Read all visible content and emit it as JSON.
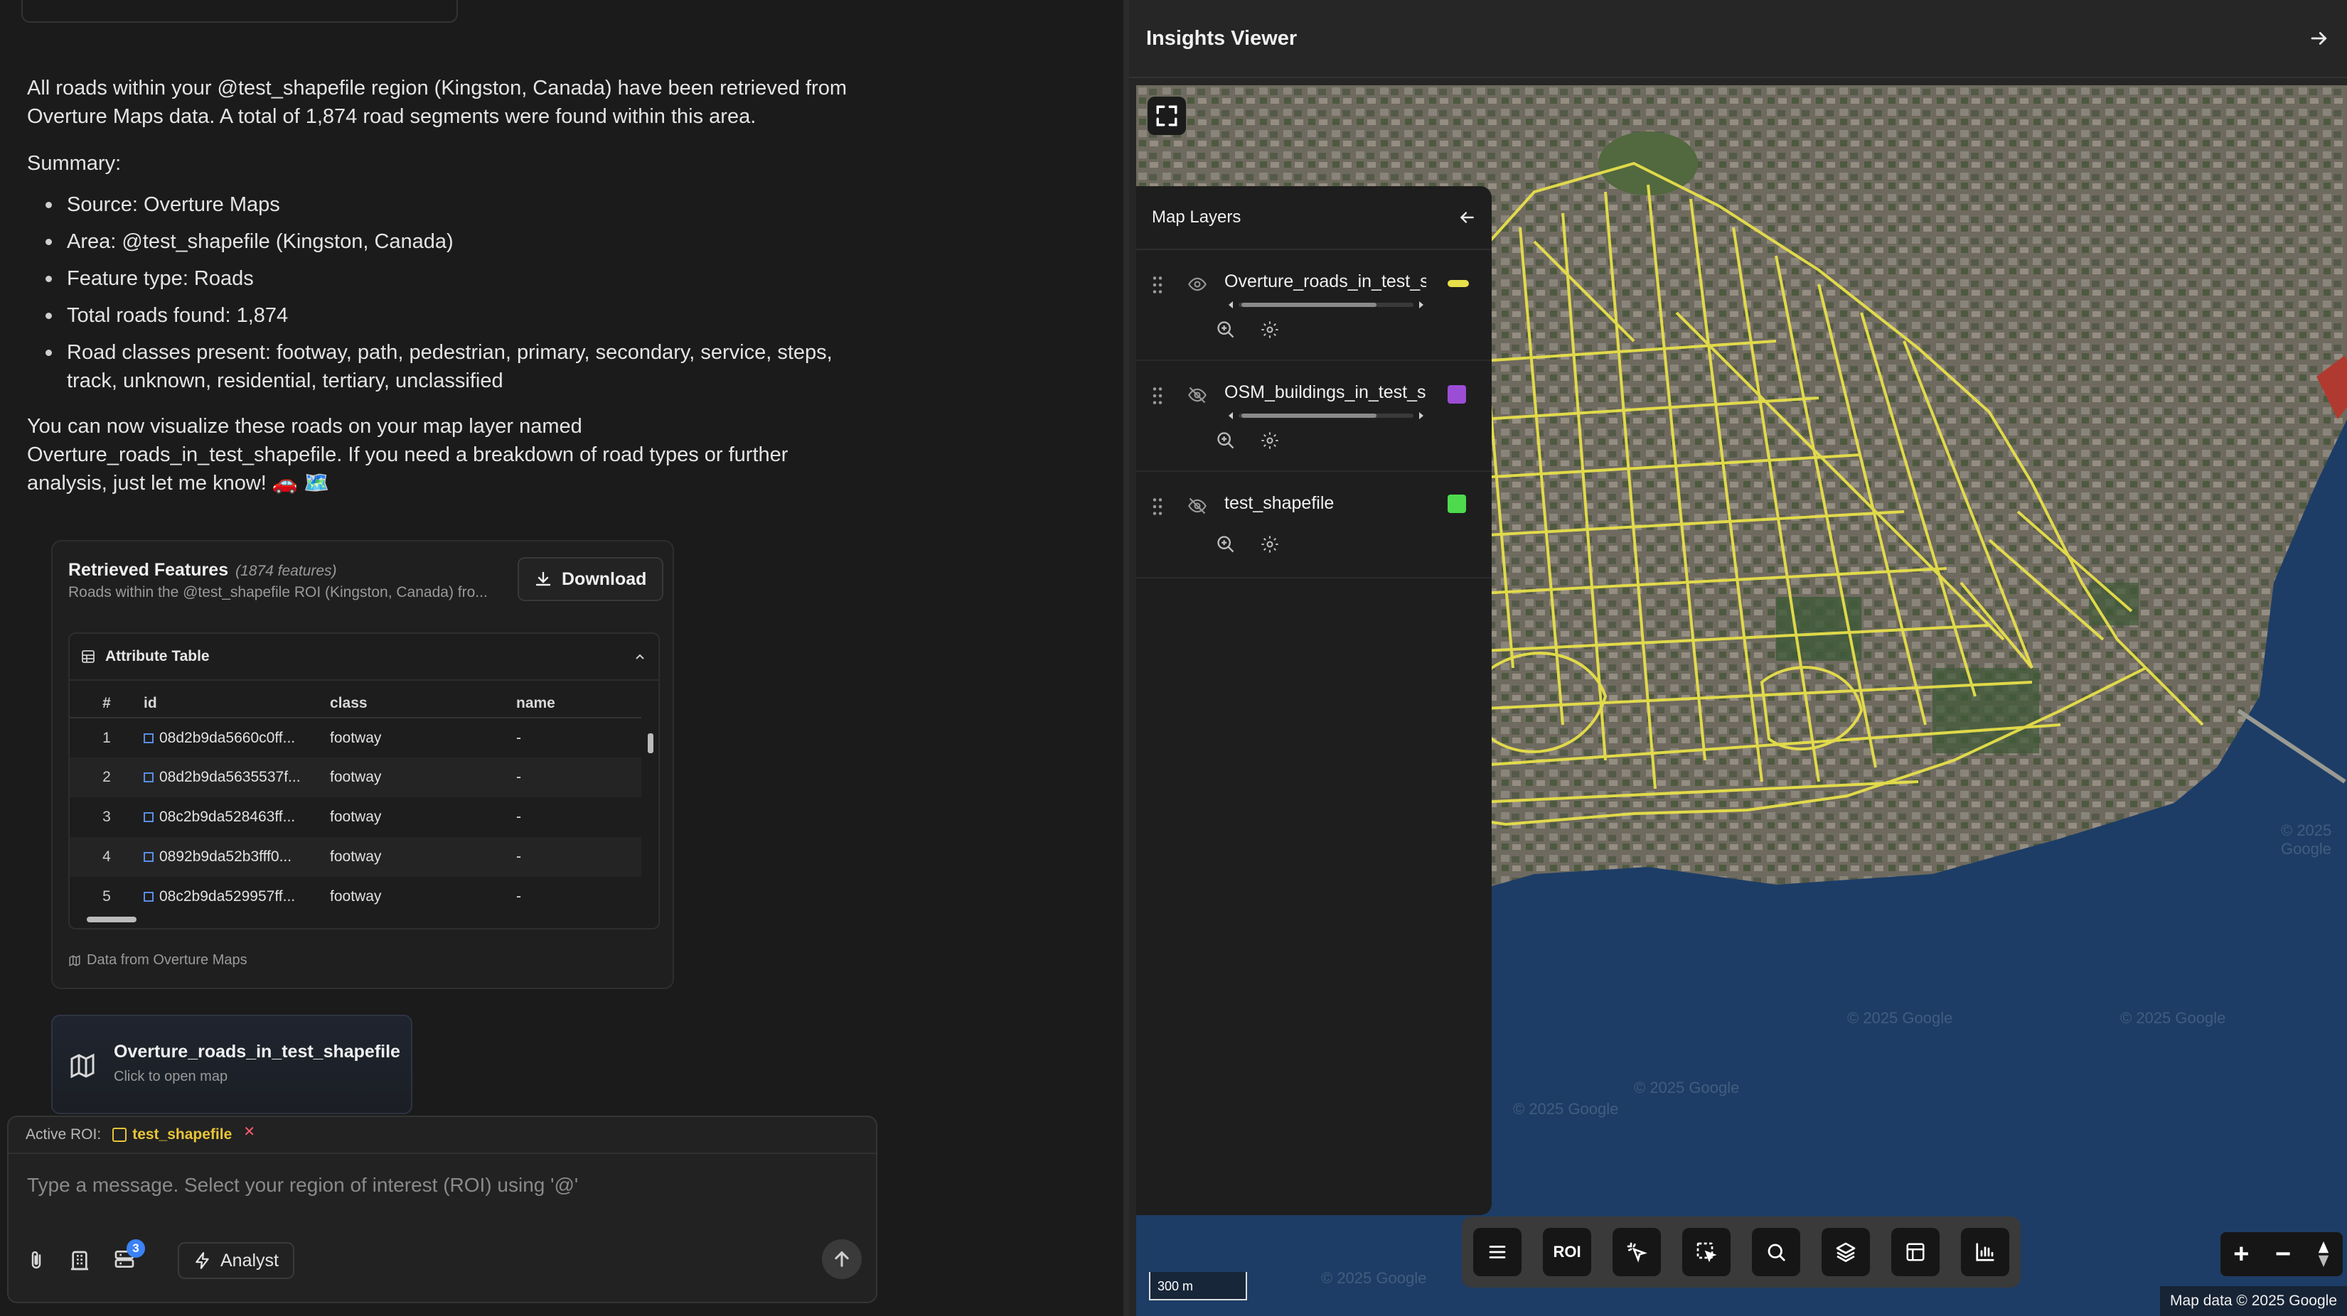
{
  "chat": {
    "intro": "All roads within your @test_shapefile region (Kingston, Canada) have been retrieved from Overture Maps data. A total of 1,874 road segments were found within this area.",
    "summary_label": "Summary:",
    "bullets": [
      "Source: Overture Maps",
      "Area: @test_shapefile (Kingston, Canada)",
      "Feature type: Roads",
      "Total roads found: 1,874",
      "Road classes present: footway, path, pedestrian, primary, secondary, service, steps, track, unknown, residential, tertiary, unclassified"
    ],
    "outro": "You can now visualize these roads on your map layer named Overture_roads_in_test_shapefile. If you need a breakdown of road types or further analysis, just let me know! 🚗 🗺️"
  },
  "features_card": {
    "title": "Retrieved Features",
    "count": "(1874 features)",
    "subtitle": "Roads within the @test_shapefile ROI (Kingston, Canada) fro...",
    "download_label": "Download",
    "table_title": "Attribute Table",
    "columns": [
      "#",
      "id",
      "class",
      "name"
    ],
    "rows": [
      {
        "n": "1",
        "id": "08d2b9da5660c0ff...",
        "class": "footway",
        "name": "-"
      },
      {
        "n": "2",
        "id": "08d2b9da5635537f...",
        "class": "footway",
        "name": "-"
      },
      {
        "n": "3",
        "id": "08c2b9da528463ff...",
        "class": "footway",
        "name": "-"
      },
      {
        "n": "4",
        "id": "0892b9da52b3fff0...",
        "class": "footway",
        "name": "-"
      },
      {
        "n": "5",
        "id": "08c2b9da529957ff...",
        "class": "footway",
        "name": "-"
      }
    ],
    "footer": "Data from Overture Maps"
  },
  "map_link": {
    "title": "Overture_roads_in_test_shapefile",
    "subtitle": "Click to open map"
  },
  "composer": {
    "roi_label": "Active ROI:",
    "roi_value": "test_shapefile",
    "placeholder": "Type a message. Select your region of interest (ROI) using '@'",
    "badge_count": "3",
    "mode_label": "Analyst"
  },
  "viewer": {
    "title": "Insights Viewer",
    "layers_title": "Map Layers",
    "layers": [
      {
        "name": "Overture_roads_in_test_sl",
        "visible": true,
        "color": "#e8e04a",
        "swatch": "line"
      },
      {
        "name": "OSM_buildings_in_test_sh",
        "visible": false,
        "color": "#9b4dd6",
        "swatch": "square"
      },
      {
        "name": "test_shapefile",
        "visible": false,
        "color": "#4ddb4d",
        "swatch": "square"
      }
    ],
    "toolbar": [
      "menu-icon",
      "ROI",
      "magic-select-icon",
      "box-select-icon",
      "search-icon",
      "layers-icon",
      "table-icon",
      "chart-icon"
    ],
    "scale": "300 m",
    "attribution": "Map data © 2025 Google",
    "watermark": "© 2025 Google"
  },
  "colors": {
    "road": "#e8e04a",
    "water": "#1d3d66",
    "accent": "#3b82f6",
    "roi": "#e8c53a"
  }
}
